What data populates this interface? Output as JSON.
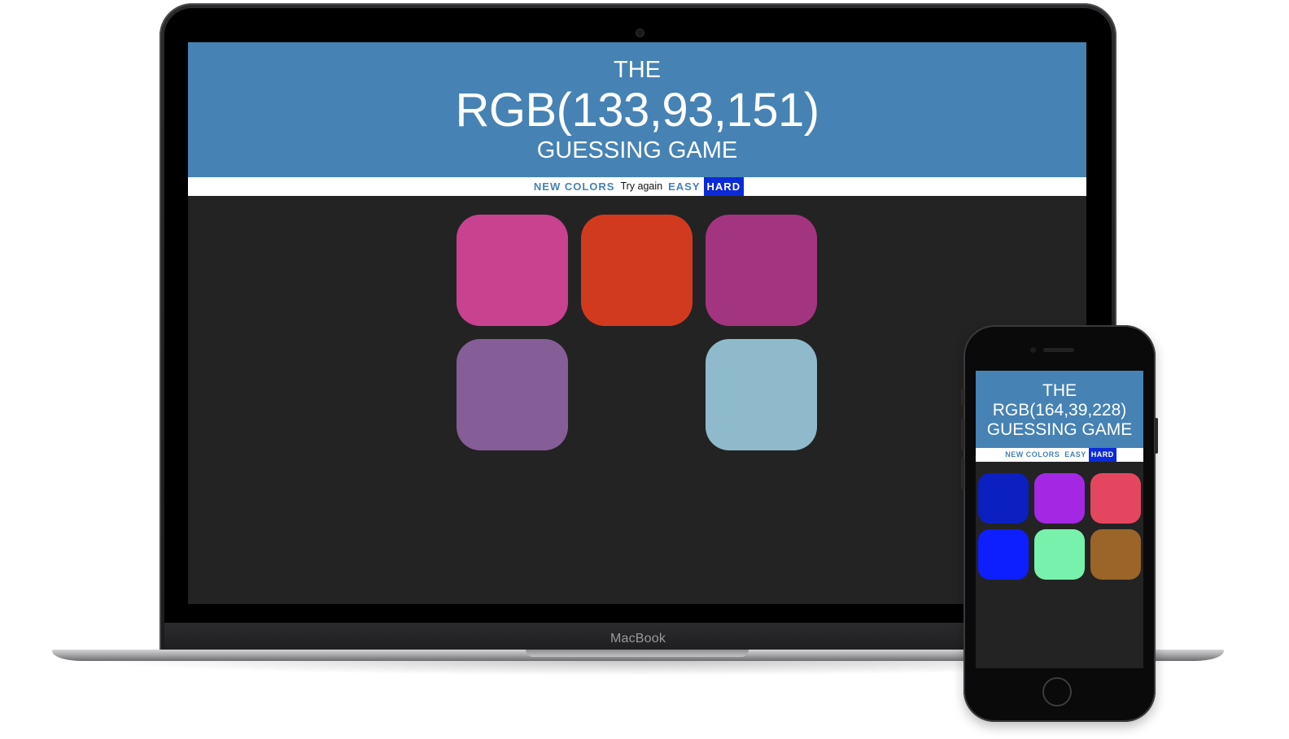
{
  "laptop": {
    "brand_label": "MacBook",
    "header": {
      "line1": "THE",
      "rgb_display": "RGB(133,93,151)",
      "line3": "GUESSING GAME",
      "color": "#4682b4"
    },
    "controls": {
      "new_colors_label": "NEW COLORS",
      "message": "Try again",
      "easy_label": "EASY",
      "hard_label": "HARD",
      "selected_mode": "HARD"
    },
    "squares": [
      {
        "color": "#c84290",
        "visible": true
      },
      {
        "color": "#d23a20",
        "visible": true
      },
      {
        "color": "#a33580",
        "visible": true
      },
      {
        "color": "#855d97",
        "visible": true
      },
      {
        "color": "#232323",
        "visible": false
      },
      {
        "color": "#8fbacc",
        "visible": true
      }
    ]
  },
  "phone": {
    "header": {
      "line1": "THE",
      "rgb_display": "RGB(164,39,228)",
      "line3": "GUESSING GAME"
    },
    "controls": {
      "new_colors_label": "NEW COLORS",
      "easy_label": "EASY",
      "hard_label": "HARD",
      "selected_mode": "HARD"
    },
    "squares": [
      {
        "color": "#0c1fc1",
        "visible": true
      },
      {
        "color": "#a427e4",
        "visible": true
      },
      {
        "color": "#e5465f",
        "visible": true
      },
      {
        "color": "#0d1fff",
        "visible": true
      },
      {
        "color": "#77f1ab",
        "visible": true
      },
      {
        "color": "#9b6429",
        "visible": true
      }
    ]
  }
}
